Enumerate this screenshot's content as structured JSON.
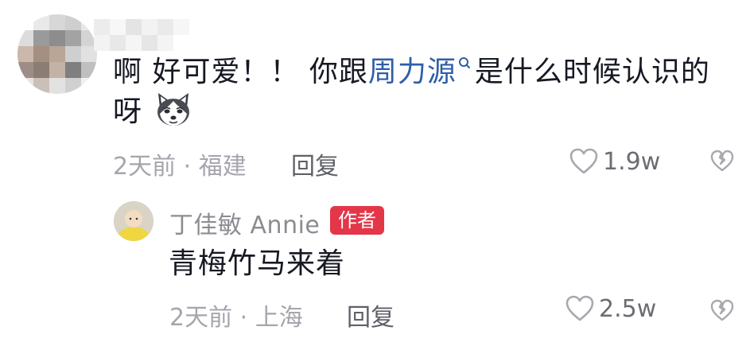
{
  "comment": {
    "text_before": "啊 好可爱！！ 你跟",
    "link_text": "周力源",
    "text_after": "是什么时候认识的",
    "text_line2": "呀",
    "emoji_icon": "husky-emoji-icon",
    "time": "2天前",
    "location": "福建",
    "reply_label": "回复",
    "like_count": "1.9w"
  },
  "reply": {
    "author": "丁佳敏 Annie",
    "badge": "作者",
    "text": "青梅竹马来着",
    "time": "2天前",
    "location": "上海",
    "reply_label": "回复",
    "like_count": "2.5w"
  },
  "colors": {
    "badge": "#e33648",
    "link": "#2f5ea8",
    "meta": "#a5a6ad"
  }
}
